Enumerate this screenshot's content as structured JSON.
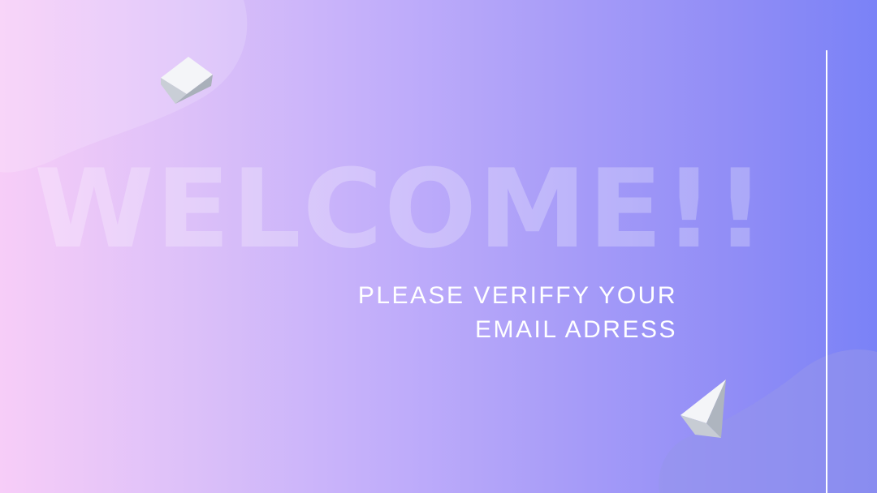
{
  "hero": {
    "headline": "WELCOME!!",
    "subtitle_line1": "PLEASE VERIFFY YOUR",
    "subtitle_line2": "EMAIL ADRESS"
  },
  "colors": {
    "gradient_start": "#f7cdf8",
    "gradient_end": "#7a82f7",
    "text": "#ffffff"
  },
  "decorations": {
    "top_shape": "cube-icon",
    "bottom_shape": "pyramid-icon"
  }
}
